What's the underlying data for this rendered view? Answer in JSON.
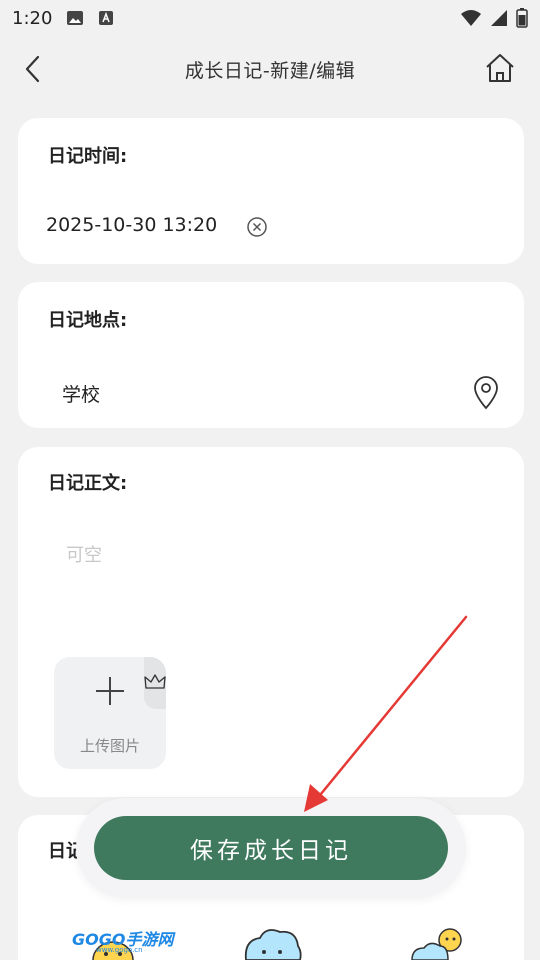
{
  "status_bar": {
    "time": "1:20",
    "icons": [
      "image-icon",
      "a-text-icon",
      "wifi-icon",
      "signal-icon",
      "battery-icon"
    ]
  },
  "nav": {
    "title": "成长日记-新建/编辑",
    "back_icon": "chevron-left-icon",
    "home_icon": "home-icon"
  },
  "time_card": {
    "label": "日记时间:",
    "value": "2025-10-30 13:20",
    "clear_icon": "clear-circle-icon"
  },
  "location_card": {
    "label": "日记地点:",
    "value": "学校",
    "icon": "location-pin-icon"
  },
  "body_card": {
    "label": "日记正文:",
    "placeholder": "可空",
    "upload_label": "上传图片",
    "crown_icon": "crown-icon"
  },
  "mood_card": {
    "label_visible": "日记"
  },
  "save_button": {
    "label": "保存成长日记"
  },
  "colors": {
    "primary": "#3f7a5f",
    "background": "#f1f1f1",
    "card": "#ffffff",
    "arrow": "#e53935"
  },
  "watermark": {
    "logo": "GOGO手游网",
    "sub": "www.gogo.cn"
  }
}
